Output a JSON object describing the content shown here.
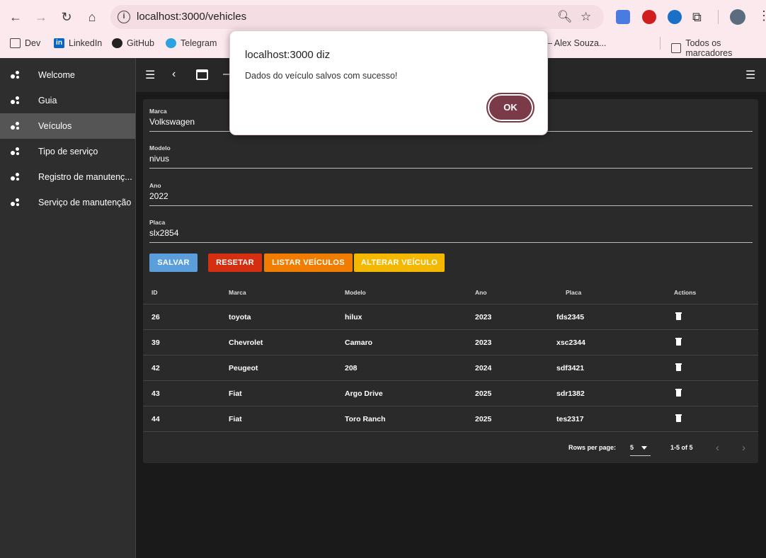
{
  "browser": {
    "url": "localhost:3000/vehicles",
    "bookmarks": [
      "Dev",
      "LinkedIn",
      "GitHub",
      "Telegram",
      "– Alex Souza...",
      "Todos os marcadores"
    ]
  },
  "sidebar": {
    "items": [
      {
        "label": "Welcome",
        "active": false
      },
      {
        "label": "Guia",
        "active": false
      },
      {
        "label": "Veículos",
        "active": true
      },
      {
        "label": "Tipo de serviço",
        "active": false
      },
      {
        "label": "Registro de manutenç...",
        "active": false
      },
      {
        "label": "Serviço de manutenção",
        "active": false
      }
    ]
  },
  "form": {
    "marca": {
      "label": "Marca",
      "value": "Volkswagen"
    },
    "modelo": {
      "label": "Modelo",
      "value": "nivus"
    },
    "ano": {
      "label": "Ano",
      "value": "2022"
    },
    "placa": {
      "label": "Placa",
      "value": "slx2854"
    }
  },
  "buttons": {
    "salvar": "SALVAR",
    "resetar": "RESETAR",
    "listar": "LISTAR VEÍCULOS",
    "alterar": "ALTERAR VEÍCULO"
  },
  "table": {
    "headers": [
      "ID",
      "Marca",
      "Modelo",
      "Ano",
      "Placa",
      "Actions"
    ],
    "rows": [
      [
        "26",
        "toyota",
        "hilux",
        "2023",
        "fds2345"
      ],
      [
        "39",
        "Chevrolet",
        "Camaro",
        "2023",
        "xsc2344"
      ],
      [
        "42",
        "Peugeot",
        "208",
        "2024",
        "sdf3421"
      ],
      [
        "43",
        "Fiat",
        "Argo Drive",
        "2025",
        "sdr1382"
      ],
      [
        "44",
        "Fiat",
        "Toro Ranch",
        "2025",
        "tes2317"
      ]
    ],
    "rows_per_page_label": "Rows per page:",
    "rows_per_page": "5",
    "range": "1-5 of 5"
  },
  "dialog": {
    "title": "localhost:3000 diz",
    "message": "Dados do veículo salvos com sucesso!",
    "ok": "OK"
  },
  "colors": {
    "salvar": "#5a9fdc",
    "resetar": "#d32f10",
    "listar": "#f07d00",
    "alterar": "#f5b800",
    "dialog_ok": "#7a3a48"
  }
}
